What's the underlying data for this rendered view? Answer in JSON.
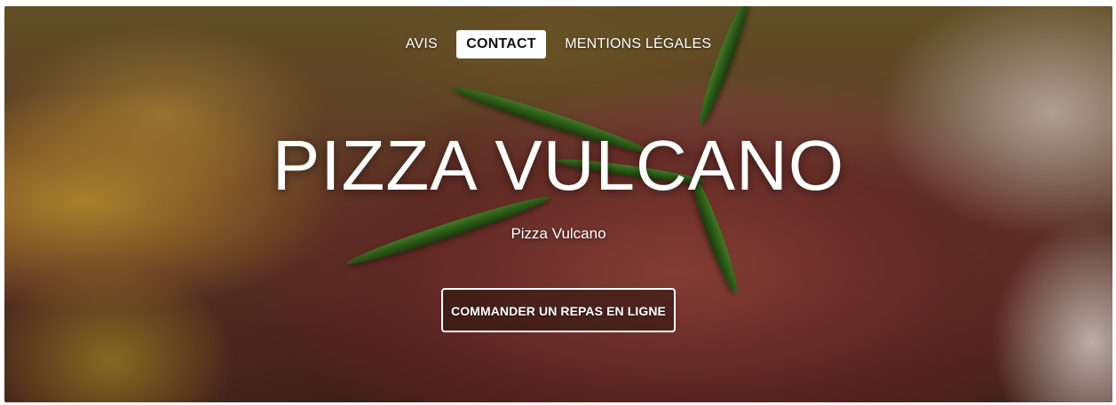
{
  "nav": {
    "items": [
      {
        "label": "AVIS",
        "active": false
      },
      {
        "label": "CONTACT",
        "active": true
      },
      {
        "label": "MENTIONS LÉGALES",
        "active": false
      }
    ]
  },
  "hero": {
    "title": "PIZZA VULCANO",
    "subtitle": "Pizza Vulcano",
    "cta_label": "COMMANDER UN REPAS EN LIGNE",
    "background_image": "grilled-steak-with-rosemary"
  },
  "colors": {
    "nav_active_bg": "#ffffff",
    "nav_active_text": "#111111",
    "text": "#ffffff"
  }
}
